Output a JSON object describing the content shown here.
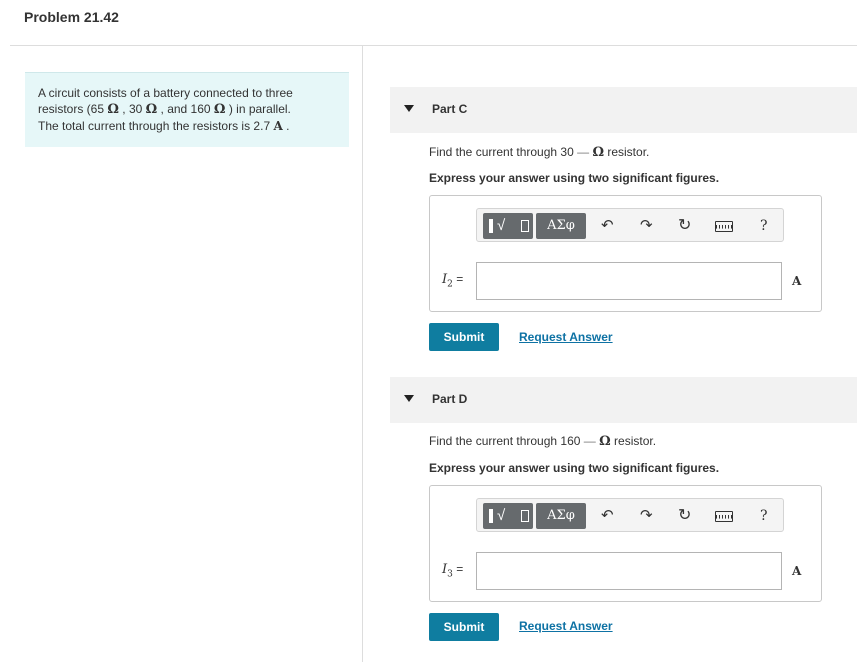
{
  "problem": {
    "title": "Problem 21.42"
  },
  "intro": {
    "line1": "A circuit consists of a battery connected to three",
    "line2_a": "resistors (65 ",
    "line2_b": " , 30 ",
    "line2_c": " , and 160 ",
    "line2_d": " ) in parallel.",
    "line3_a": "The total current through the resistors is 2.7 ",
    "line3_unit": "A",
    "line3_end": " .",
    "ohm": "Ω"
  },
  "toolbar": {
    "greek_label": "ΑΣφ",
    "undo_glyph": "↶",
    "redo_glyph": "↷",
    "reset_glyph": "↻",
    "help_glyph": "?",
    "icons": [
      "templates-icon",
      "greek-symbols-icon",
      "undo-icon",
      "redo-icon",
      "reset-icon",
      "keyboard-icon",
      "help-icon"
    ]
  },
  "parts": [
    {
      "label": "Part C",
      "question_a": "Find the current through 30 ",
      "question_dash": "—",
      "question_ohm": "Ω",
      "question_b": " resistor.",
      "instruction": "Express your answer using two significant figures.",
      "var_symbol": "I",
      "var_subscript": "2",
      "var_eq": " =",
      "input_value": "",
      "unit": "A",
      "submit_label": "Submit",
      "request_label": "Request Answer"
    },
    {
      "label": "Part D",
      "question_a": "Find the current through 160 ",
      "question_dash": "—",
      "question_ohm": "Ω",
      "question_b": " resistor.",
      "instruction": "Express your answer using two significant figures.",
      "var_symbol": "I",
      "var_subscript": "3",
      "var_eq": " =",
      "input_value": "",
      "unit": "A",
      "submit_label": "Submit",
      "request_label": "Request Answer"
    }
  ]
}
